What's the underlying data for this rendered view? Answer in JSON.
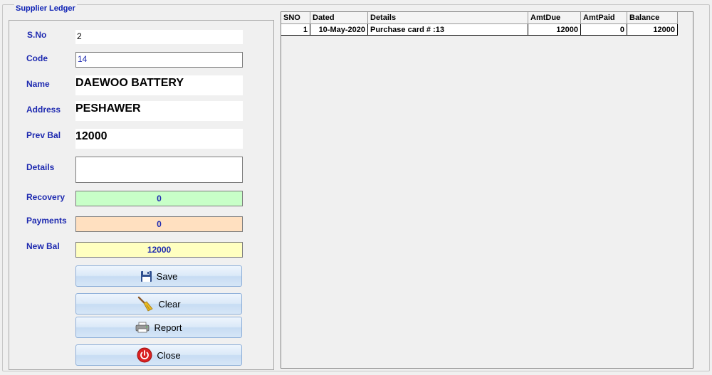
{
  "form_title": "Supplier Ledger",
  "labels": {
    "sno": "S.No",
    "code": "Code",
    "name": "Name",
    "address": "Address",
    "prev_bal": "Prev Bal",
    "details": "Details",
    "recovery": "Recovery",
    "payments": "Payments",
    "new_bal": "New Bal"
  },
  "fields": {
    "sno": "2",
    "code": "14",
    "name": "DAEWOO BATTERY",
    "address": "PESHAWER",
    "prev_bal": "12000",
    "details": "",
    "recovery": "0",
    "payments": "0",
    "new_bal": "12000"
  },
  "colors": {
    "label": "#1e2ab0",
    "recovery_bg": "#c8ffc8",
    "payments_bg": "#ffe0c0",
    "new_bal_bg": "#ffffc0"
  },
  "buttons": {
    "save": "Save",
    "clear": "Clear",
    "report": "Report",
    "close": "Close"
  },
  "icons": {
    "save": "floppy-disk-icon",
    "clear": "broom-icon",
    "report": "printer-icon",
    "close": "power-icon"
  },
  "table": {
    "columns": [
      "SNO",
      "Dated",
      "Details",
      "AmtDue",
      "AmtPaid",
      "Balance"
    ],
    "rows": [
      [
        "1",
        "10-May-2020",
        "Purchase card  # :13",
        "12000",
        "0",
        "12000"
      ]
    ]
  }
}
